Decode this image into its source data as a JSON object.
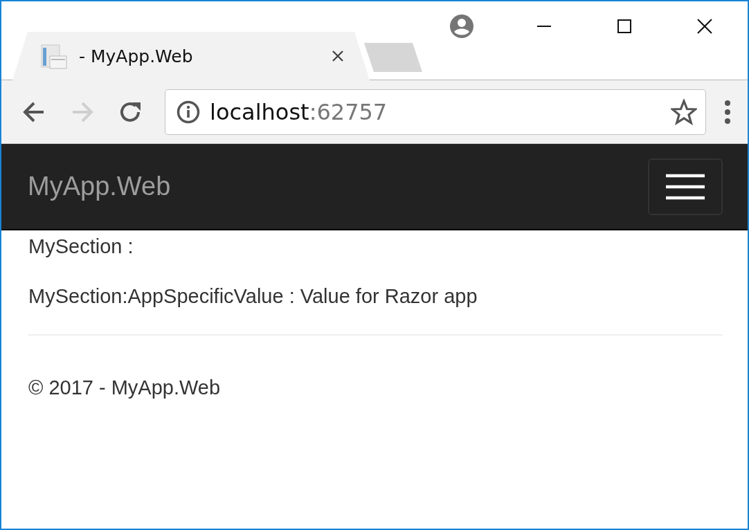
{
  "tab": {
    "title": "- MyApp.Web",
    "selected": true
  },
  "toolbar": {
    "forward_disabled": true
  },
  "address": {
    "host": "localhost",
    "port": ":62757"
  },
  "navbar": {
    "brand": "MyApp.Web"
  },
  "content": {
    "lines": [
      "MySection :",
      "MySection:AppSpecificValue : Value for Razor app"
    ]
  },
  "footer": {
    "text": "© 2017 - MyApp.Web"
  }
}
